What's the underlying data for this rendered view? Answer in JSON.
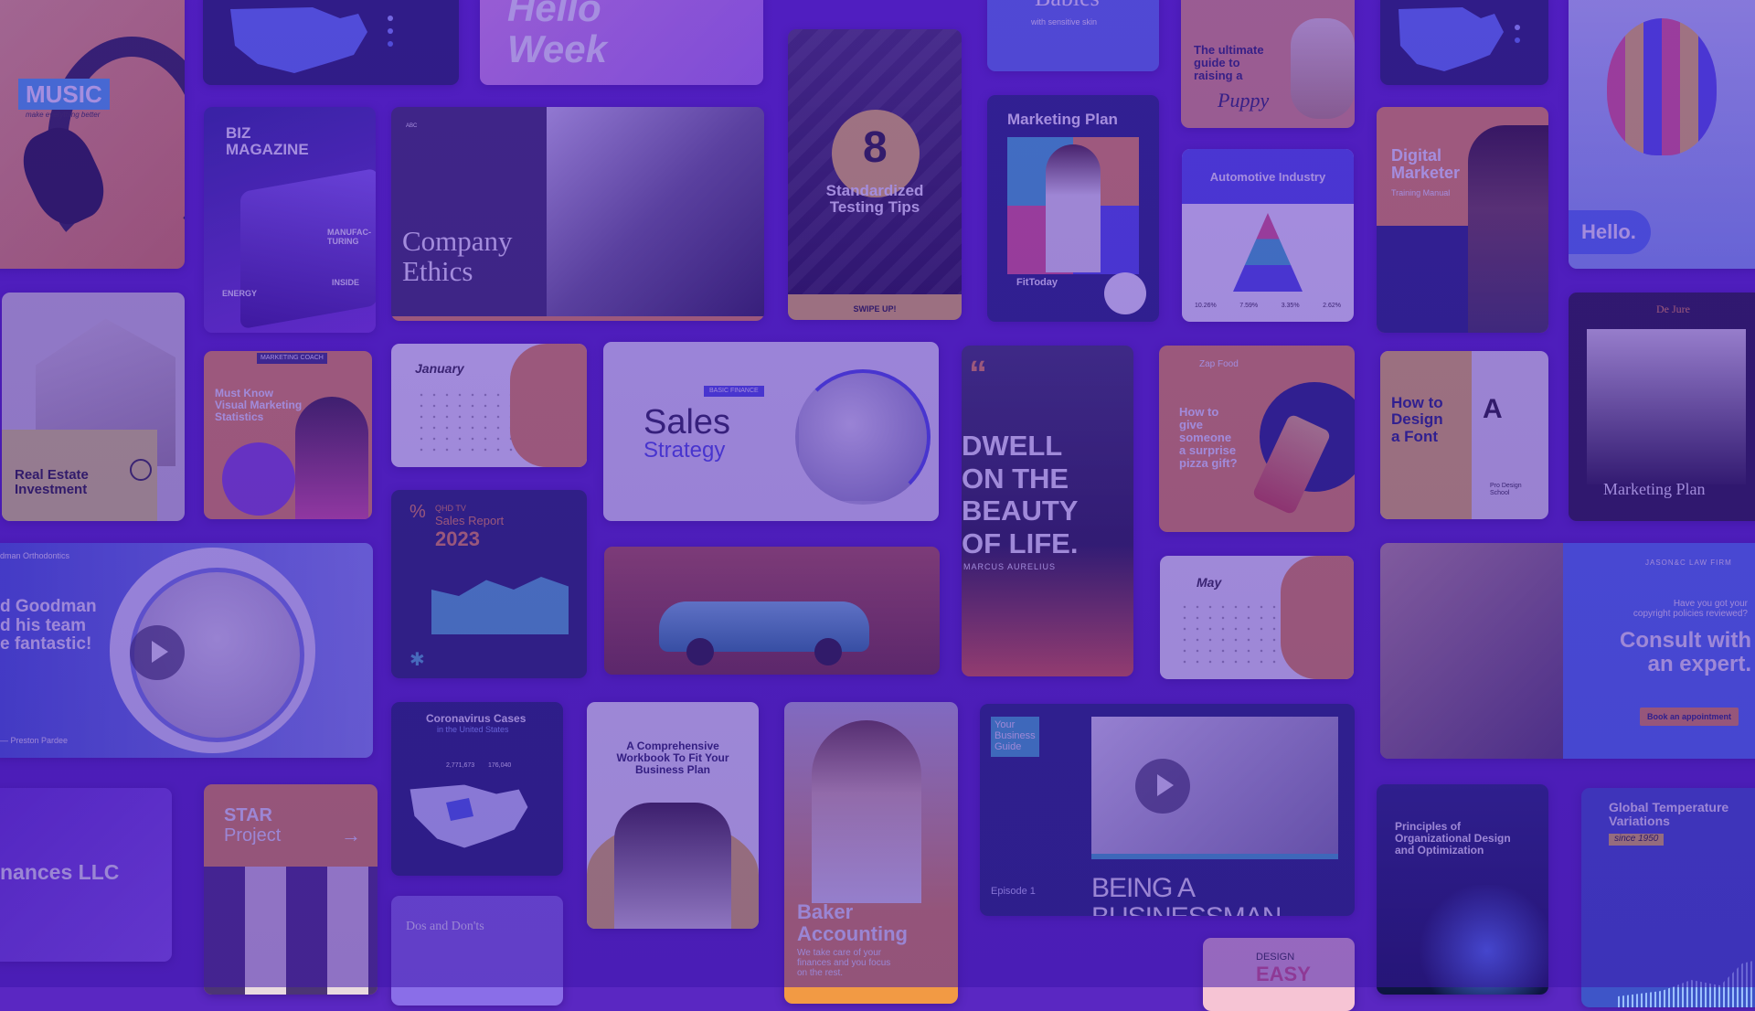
{
  "tiles": {
    "music": {
      "title": "MUSIC",
      "tagline": "make everything better"
    },
    "biz": {
      "title": "BIZ\nMAGAZINE",
      "side": "MANUFAC-\nTURING",
      "inside": "INSIDE",
      "energy": "ENERGY"
    },
    "ethics": {
      "title": "Company\nEthics"
    },
    "testing": {
      "number": "8",
      "title": "Standardized\nTesting Tips",
      "cta": "SWIPE UP!"
    },
    "marketing1": {
      "title": "Marketing Plan",
      "brand": "FitToday"
    },
    "puppy": {
      "title": "The ultimate\nguide to\nraising a",
      "script": "Puppy"
    },
    "automotive": {
      "title": "Automotive Industry",
      "values": [
        "10.26%",
        "7.59%",
        "3.35%",
        "2.62%"
      ]
    },
    "digital": {
      "title": "Digital\nMarketer",
      "subtitle": "Training Manual"
    },
    "hello": {
      "text": "Hello."
    },
    "realestate": {
      "title": "Real Estate\nInvestment"
    },
    "visualmkt": {
      "tag": "MARKETING COACH",
      "title": "Must Know\nVisual Marketing\nStatistics"
    },
    "january": {
      "title": "January"
    },
    "sales": {
      "tag": "BASIC FINANCE",
      "title": "Sales",
      "subtitle": "Strategy"
    },
    "dwell": {
      "title": "DWELL\nON THE\nBEAUTY\nOF LIFE.",
      "author": "MARCUS AURELIUS"
    },
    "pizza": {
      "brand": "Zap Food",
      "title": "How to\ngive\nsomeone\na surprise\npizza gift?"
    },
    "font": {
      "title": "How to\nDesign\na Font",
      "school": "Pro Design\nSchool"
    },
    "dejure": {
      "brand": "De Jure",
      "title": "Marketing Plan"
    },
    "ortho": {
      "brand": "dman Orthodontics",
      "title": "d Goodman\nd his team\ne fantastic!",
      "author": "— Preston Pardee"
    },
    "salesreport": {
      "label": "QHD TV",
      "title": "Sales Report",
      "year": "2023"
    },
    "may": {
      "title": "May"
    },
    "consult": {
      "brand": "JASON&C LAW FIRM",
      "question": "Have you got your\ncopyright policies reviewed?",
      "title": "Consult with\nan expert.",
      "button": "Book an appointment"
    },
    "llc": {
      "title": "nances LLC"
    },
    "star": {
      "title": "STAR",
      "subtitle": "Project"
    },
    "corona": {
      "title": "Coronavirus Cases",
      "subtitle": "in the United States",
      "stat1": "2,771,673",
      "stat2": "176,040"
    },
    "workbook": {
      "title": "A Comprehensive\nWorkbook To Fit Your\nBusiness Plan"
    },
    "baker": {
      "title": "Baker\nAccounting",
      "body": "We take care of your\nfinances and you focus\non the rest."
    },
    "business": {
      "tag": "Your\nBusiness\nGuide",
      "episode": "Episode 1",
      "title": "BEING A BUSINESSMAN"
    },
    "principles": {
      "title": "Principles of\nOrganizational Design\nand Optimization"
    },
    "temperature": {
      "title": "Global Temperature\nVariations",
      "since": "since 1950"
    },
    "dos": {
      "title": "Dos and Don'ts"
    },
    "design": {
      "label": "DESIGN",
      "title": "EASY"
    },
    "hellowk": {
      "title": "Hello\nWeek"
    },
    "babies": {
      "title": "Babies",
      "subtitle": "with sensitive skin"
    }
  },
  "colors": {
    "background": "#5a27c2",
    "orange": "#f29a44",
    "navy": "#1f2a6b",
    "yellow": "#f2c94c"
  }
}
